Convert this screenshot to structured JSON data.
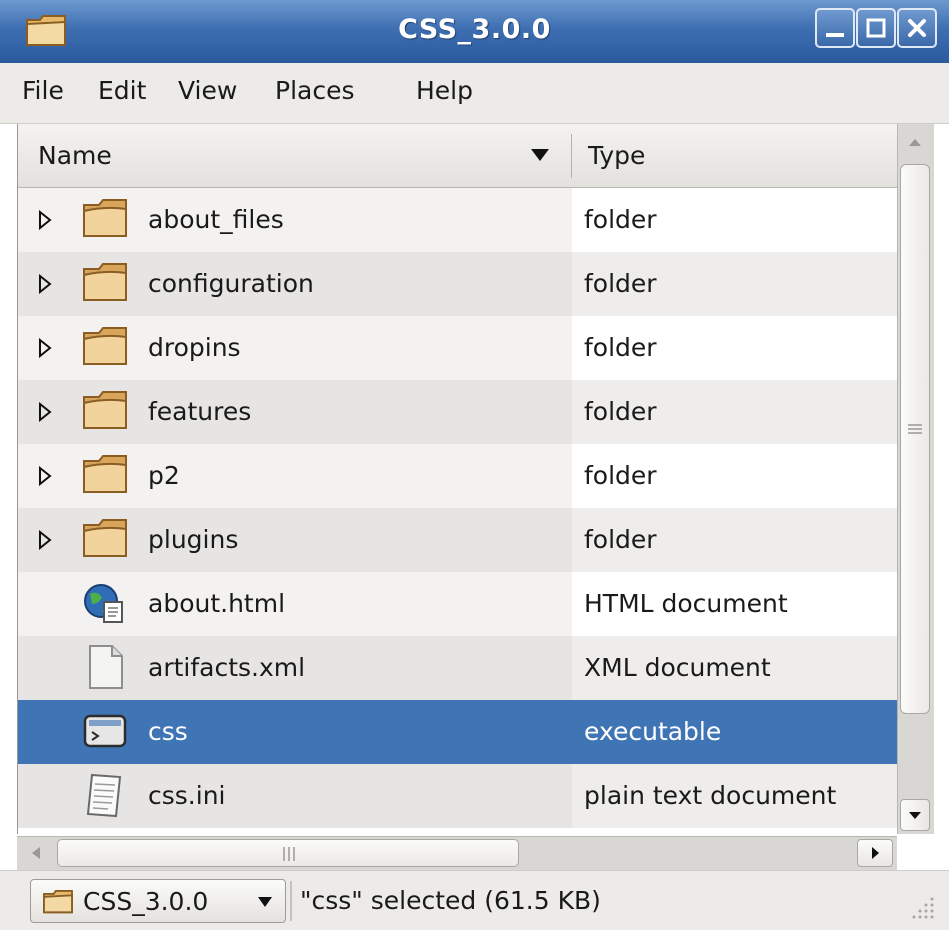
{
  "window": {
    "title": "CSS_3.0.0",
    "accent_color": "#3e6fb2",
    "selection_color": "#3f74b5"
  },
  "menu": [
    {
      "label": "File"
    },
    {
      "label": "Edit"
    },
    {
      "label": "View"
    },
    {
      "label": "Places"
    },
    {
      "label": "Help"
    }
  ],
  "columns": {
    "name": "Name",
    "type": "Type"
  },
  "files": [
    {
      "name": "about_files",
      "type": "folder",
      "icon": "folder-icon",
      "expandable": true
    },
    {
      "name": "configuration",
      "type": "folder",
      "icon": "folder-icon",
      "expandable": true
    },
    {
      "name": "dropins",
      "type": "folder",
      "icon": "folder-icon",
      "expandable": true
    },
    {
      "name": "features",
      "type": "folder",
      "icon": "folder-icon",
      "expandable": true
    },
    {
      "name": "p2",
      "type": "folder",
      "icon": "folder-icon",
      "expandable": true
    },
    {
      "name": "plugins",
      "type": "folder",
      "icon": "folder-icon",
      "expandable": true
    },
    {
      "name": "about.html",
      "type": "HTML document",
      "icon": "html-document-icon",
      "expandable": false
    },
    {
      "name": "artifacts.xml",
      "type": "XML document",
      "icon": "document-icon",
      "expandable": false
    },
    {
      "name": "css",
      "type": "executable",
      "icon": "executable-icon",
      "expandable": false,
      "selected": true
    },
    {
      "name": "css.ini",
      "type": "plain text document",
      "icon": "text-document-icon",
      "expandable": false
    }
  ],
  "statusbar": {
    "location": "CSS_3.0.0",
    "status_text": "\"css\" selected (61.5 KB)"
  }
}
